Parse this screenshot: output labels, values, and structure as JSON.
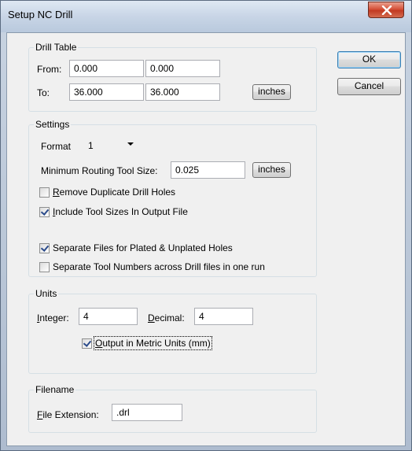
{
  "window": {
    "title": "Setup NC Drill"
  },
  "buttons": {
    "ok": "OK",
    "cancel": "Cancel"
  },
  "drill_table": {
    "legend": "Drill Table",
    "from_label": "From:",
    "to_label": "To:",
    "from_x": "0.000",
    "from_y": "0.000",
    "to_x": "36.000",
    "to_y": "36.000",
    "units_button": "inches"
  },
  "settings": {
    "legend": "Settings",
    "format_label": "Format",
    "format_value": "1",
    "min_routing_label": "Minimum Routing Tool Size:",
    "min_routing_value": "0.025",
    "units_button": "inches",
    "remove_duplicate": {
      "label_first": "R",
      "label_rest": "emove Duplicate Drill Holes",
      "checked": false
    },
    "include_tool_sizes": {
      "label_first": "I",
      "label_rest": "nclude Tool Sizes In Output File",
      "checked": true
    },
    "separate_files": {
      "label": "Separate Files for Plated & Unplated Holes",
      "checked": true
    },
    "separate_tool_numbers": {
      "label": "Separate Tool Numbers across Drill files in one run",
      "checked": false
    }
  },
  "units": {
    "legend": "Units",
    "integer_label_first": "I",
    "integer_label_rest": "nteger:",
    "integer_value": "4",
    "decimal_label_first": "D",
    "decimal_label_rest": "ecimal:",
    "decimal_value": "4",
    "output_metric": {
      "label_first": "O",
      "label_rest": "utput in Metric Units (mm)",
      "checked": true
    }
  },
  "filename": {
    "legend": "Filename",
    "ext_label_first": "F",
    "ext_label_rest": "ile Extension:",
    "ext_value": ".drl"
  }
}
